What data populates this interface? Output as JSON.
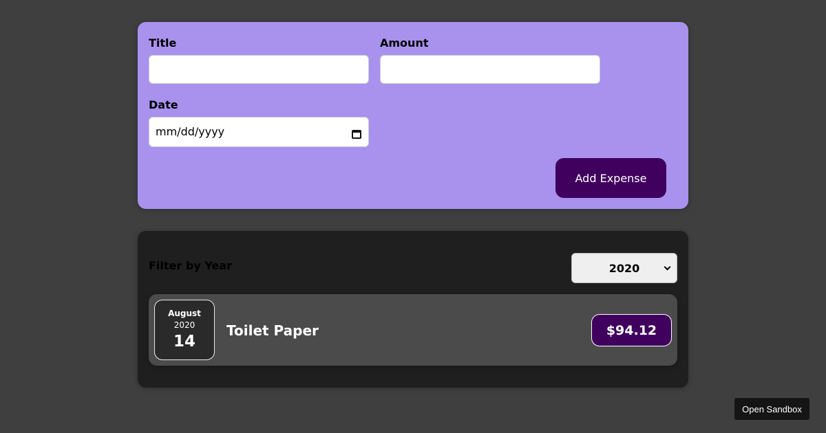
{
  "form": {
    "title_label": "Title",
    "title_value": "",
    "amount_label": "Amount",
    "amount_value": "",
    "date_label": "Date",
    "date_placeholder": "mm/dd/yyyy",
    "date_icon": "calendar-icon",
    "submit_label": "Add Expense"
  },
  "filter": {
    "label": "Filter by Year",
    "selected_year": "2020",
    "icon": "chevron-down-icon"
  },
  "expenses": [
    {
      "month": "August",
      "year": "2020",
      "day": "14",
      "title": "Toilet Paper",
      "amount": "$94.12"
    }
  ],
  "sandbox": {
    "label": "Open Sandbox"
  },
  "colors": {
    "background": "#3f3f3f",
    "form_background": "#a892ee",
    "accent": "#40005d",
    "card_background": "#1f1f1f",
    "item_background": "#4b4b4b"
  }
}
